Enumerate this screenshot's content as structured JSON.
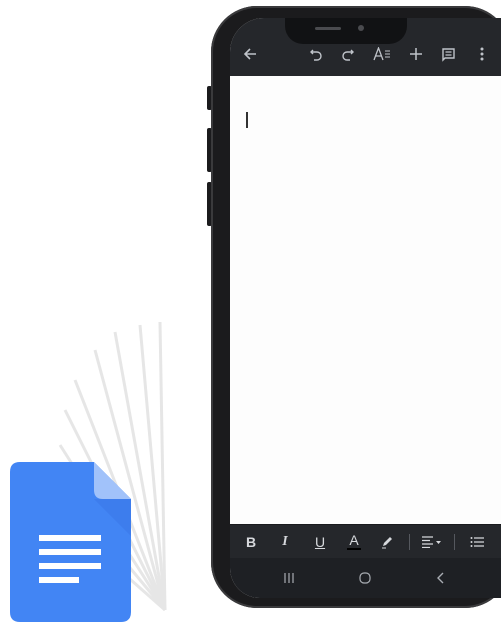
{
  "logo": {
    "name": "google-docs-logo",
    "brand_color": "#4285f4",
    "fold_color": "#a1c2fa"
  },
  "phone": {
    "frame_color": "#1b1b1d"
  },
  "app_bar": {
    "background": "#25272b",
    "icons": [
      "back-arrow-icon",
      "undo-icon",
      "redo-icon",
      "text-format-icon",
      "add-icon",
      "comment-icon",
      "more-vert-icon"
    ]
  },
  "document": {
    "body_text": ""
  },
  "format_toolbar": {
    "bold_label": "B",
    "italic_label": "I",
    "underline_label": "U",
    "text_color_label": "A",
    "icons": [
      "bold-icon",
      "italic-icon",
      "underline-icon",
      "text-color-icon",
      "highlight-icon",
      "align-icon",
      "list-icon"
    ]
  },
  "nav_bar": {
    "icons": [
      "recents-icon",
      "home-icon",
      "back-icon"
    ]
  }
}
